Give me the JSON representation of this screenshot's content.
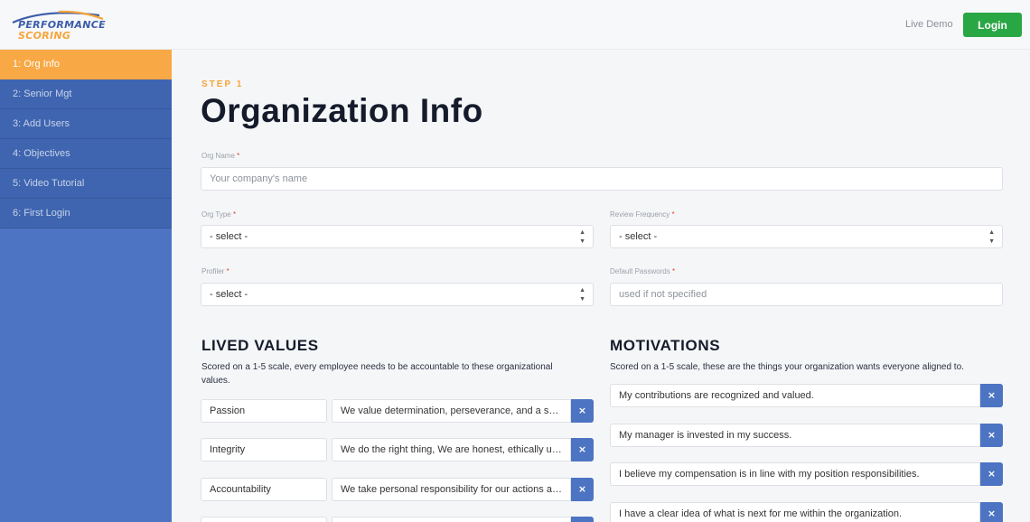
{
  "header": {
    "logo_line1": "PERFORMANCE",
    "logo_line2": "SCORING",
    "live_demo": "Live Demo",
    "login": "Login"
  },
  "sidebar": {
    "items": [
      {
        "label": "1: Org Info",
        "active": true
      },
      {
        "label": "2: Senior Mgt"
      },
      {
        "label": "3: Add Users"
      },
      {
        "label": "4: Objectives"
      },
      {
        "label": "5: Video Tutorial"
      },
      {
        "label": "6: First Login"
      }
    ]
  },
  "page": {
    "step": "STEP 1",
    "title": "Organization Info"
  },
  "form": {
    "org_name": {
      "label": "Org Name",
      "required": "*",
      "placeholder": "Your company's name"
    },
    "org_type": {
      "label": "Org Type",
      "required": "*",
      "value": "- select -"
    },
    "review_frequency": {
      "label": "Review Frequency",
      "required": "*",
      "value": "- select -"
    },
    "profiler": {
      "label": "Profiler",
      "required": "*",
      "value": "- select -"
    },
    "default_passwords": {
      "label": "Default Passwords",
      "required": "*",
      "placeholder": "used if not specified"
    }
  },
  "lived_values": {
    "title": "LIVED VALUES",
    "desc_line1": "Scored on a 1-5 scale, every employee needs to be accountable to these organizational",
    "desc_line2": "values.",
    "rows": [
      {
        "name": "Passion",
        "text": "We value determination, perseverance, and a sense of urgency"
      },
      {
        "name": "Integrity",
        "text": "We do the right thing, We are honest, ethically unwavering"
      },
      {
        "name": "Accountability",
        "text": "We take personal responsibility for our actions and results"
      }
    ]
  },
  "motivations": {
    "title": "MOTIVATIONS",
    "desc": "Scored on a 1-5 scale, these are the things your organization wants everyone aligned to.",
    "rows": [
      {
        "text": "My contributions are recognized and valued."
      },
      {
        "text": "My manager is invested in my success."
      },
      {
        "text": "I believe my compensation is in line with my position responsibilities."
      },
      {
        "text": "I have a clear idea of what is next for me within the organization."
      }
    ]
  },
  "icons": {
    "remove": "×",
    "select_arrow": "▲▼"
  },
  "colors": {
    "accent": "#f8a844",
    "brand_blue": "#4c74c2",
    "sidebar_item": "#3f65b0",
    "login_green": "#2aa745",
    "required": "#e0453a"
  }
}
